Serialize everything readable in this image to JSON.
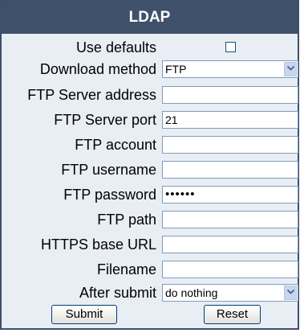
{
  "title": "LDAP",
  "rows": {
    "use_defaults": {
      "label": "Use defaults",
      "checked": false
    },
    "download_method": {
      "label": "Download method",
      "value": "FTP"
    },
    "ftp_server_address": {
      "label": "FTP Server address",
      "value": ""
    },
    "ftp_server_port": {
      "label": "FTP Server port",
      "value": "21"
    },
    "ftp_account": {
      "label": "FTP account",
      "value": ""
    },
    "ftp_username": {
      "label": "FTP username",
      "value": ""
    },
    "ftp_password": {
      "label": "FTP password",
      "value": "••••••"
    },
    "ftp_path": {
      "label": "FTP path",
      "value": ""
    },
    "https_base_url": {
      "label": "HTTPS base URL",
      "value": ""
    },
    "filename": {
      "label": "Filename",
      "value": ""
    },
    "after_submit": {
      "label": "After submit",
      "value": "do nothing"
    }
  },
  "buttons": {
    "submit": "Submit",
    "reset": "Reset"
  },
  "colors": {
    "header_bg": "#3f506b",
    "panel_bg": "#e9eef5",
    "field_border": "#7f9db9"
  }
}
